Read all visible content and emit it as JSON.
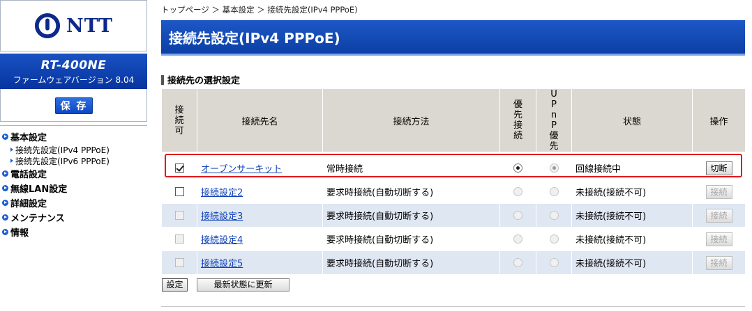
{
  "brand": {
    "logo_text": "NTT",
    "model": "RT-400NE",
    "firmware": "ファームウェアバージョン 8.04",
    "save_label": "保 存"
  },
  "nav": {
    "items": [
      {
        "label": "基本設定",
        "subs": [
          "接続先設定(IPv4 PPPoE)",
          "接続先設定(IPv6 PPPoE)"
        ]
      },
      {
        "label": "電話設定"
      },
      {
        "label": "無線LAN設定"
      },
      {
        "label": "詳細設定"
      },
      {
        "label": "メンテナンス"
      },
      {
        "label": "情報"
      }
    ]
  },
  "breadcrumb": "トップページ ＞ 基本設定 ＞ 接続先設定(IPv4 PPPoE)",
  "page_title": "接続先設定(IPv4 PPPoE)",
  "section_title": "接続先の選択設定",
  "table": {
    "headers": {
      "enable": "接続可",
      "name": "接続先名",
      "method": "接続方法",
      "priority": "優先接続",
      "upnp": "UPnP優先",
      "status": "状態",
      "action": "操作"
    },
    "rows": [
      {
        "enabled": true,
        "name": "オープンサーキット",
        "method": "常時接続",
        "priority": true,
        "upnp": true,
        "status": "回線接続中",
        "action": "切断",
        "action_enabled": true
      },
      {
        "enabled": false,
        "name": "接続設定2",
        "method": "要求時接続(自動切断する)",
        "priority": false,
        "upnp": false,
        "status": "未接続(接続不可)",
        "action": "接続",
        "action_enabled": false
      },
      {
        "enabled": false,
        "name": "接続設定3",
        "method": "要求時接続(自動切断する)",
        "priority": false,
        "upnp": false,
        "status": "未接続(接続不可)",
        "action": "接続",
        "action_enabled": false
      },
      {
        "enabled": false,
        "name": "接続設定4",
        "method": "要求時接続(自動切断する)",
        "priority": false,
        "upnp": false,
        "status": "未接続(接続不可)",
        "action": "接続",
        "action_enabled": false
      },
      {
        "enabled": false,
        "name": "接続設定5",
        "method": "要求時接続(自動切断する)",
        "priority": false,
        "upnp": false,
        "status": "未接続(接続不可)",
        "action": "接続",
        "action_enabled": false
      }
    ]
  },
  "buttons": {
    "set": "設定",
    "refresh": "最新状態に更新"
  },
  "colors": {
    "brand_blue": "#0c3fa6",
    "highlight_red": "#e0181c",
    "header_gray": "#dad8d0",
    "row_light": "#dfe7f3"
  }
}
